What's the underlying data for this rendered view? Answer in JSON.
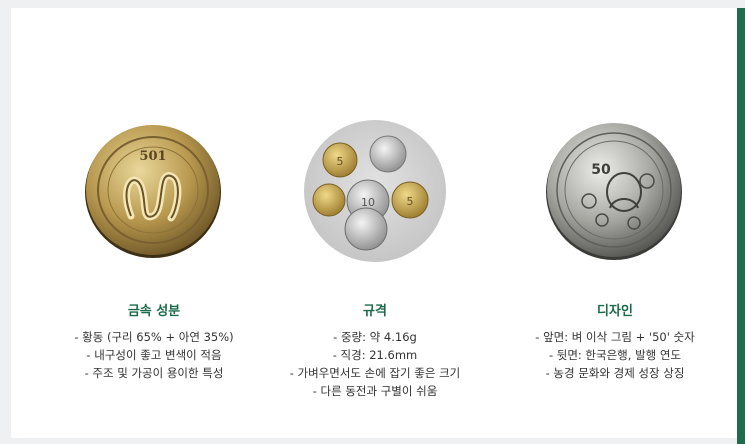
{
  "colors": {
    "accent": "#1f6b4b",
    "title": "#1d6a4a",
    "text": "#333333"
  },
  "sections": [
    {
      "title": "금속 성분",
      "icon": "brass-coin-image",
      "items": [
        "- 황동 (구리 65% + 아연 35%)",
        "- 내구성이 좋고 변색이 적음",
        "- 주조 및 가공이 용이한 특성"
      ]
    },
    {
      "title": "규격",
      "icon": "coin-pile-image",
      "items": [
        "- 중량: 약 4.16g",
        "- 직경: 21.6mm",
        "- 가벼우면서도 손에 잡기 좋은 크기",
        "- 다른 동전과 구별이 쉬움"
      ]
    },
    {
      "title": "디자인",
      "icon": "silver-coin-image",
      "items": [
        "- 앞면: 벼 이삭 그림 + '50' 숫자",
        "- 뒷면: 한국은행, 발행 연도",
        "- 농경 문화와 경제 성장 상징"
      ]
    }
  ]
}
